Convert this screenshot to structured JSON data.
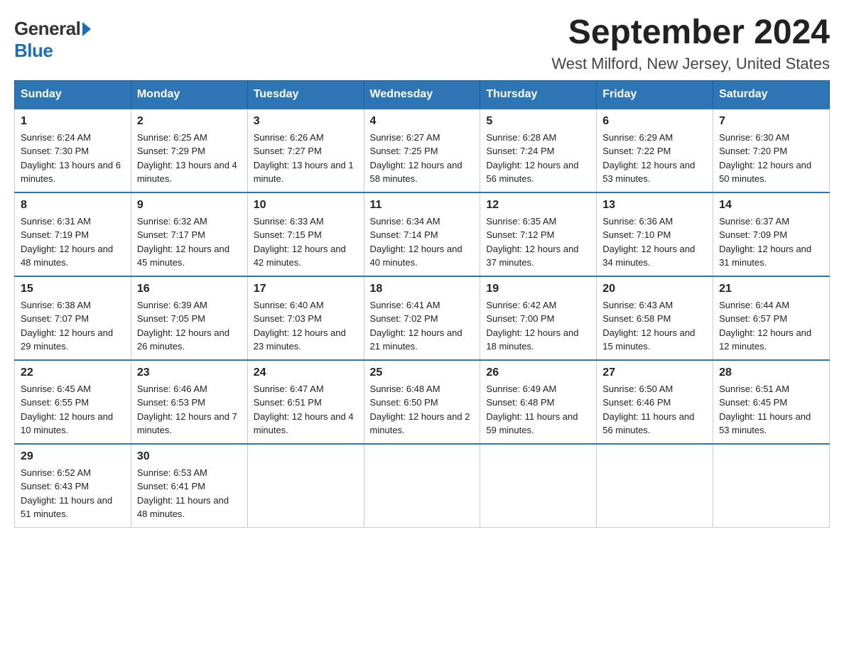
{
  "logo": {
    "general": "General",
    "blue": "Blue"
  },
  "title": "September 2024",
  "subtitle": "West Milford, New Jersey, United States",
  "days_of_week": [
    "Sunday",
    "Monday",
    "Tuesday",
    "Wednesday",
    "Thursday",
    "Friday",
    "Saturday"
  ],
  "weeks": [
    [
      {
        "day": "1",
        "sunrise": "Sunrise: 6:24 AM",
        "sunset": "Sunset: 7:30 PM",
        "daylight": "Daylight: 13 hours and 6 minutes."
      },
      {
        "day": "2",
        "sunrise": "Sunrise: 6:25 AM",
        "sunset": "Sunset: 7:29 PM",
        "daylight": "Daylight: 13 hours and 4 minutes."
      },
      {
        "day": "3",
        "sunrise": "Sunrise: 6:26 AM",
        "sunset": "Sunset: 7:27 PM",
        "daylight": "Daylight: 13 hours and 1 minute."
      },
      {
        "day": "4",
        "sunrise": "Sunrise: 6:27 AM",
        "sunset": "Sunset: 7:25 PM",
        "daylight": "Daylight: 12 hours and 58 minutes."
      },
      {
        "day": "5",
        "sunrise": "Sunrise: 6:28 AM",
        "sunset": "Sunset: 7:24 PM",
        "daylight": "Daylight: 12 hours and 56 minutes."
      },
      {
        "day": "6",
        "sunrise": "Sunrise: 6:29 AM",
        "sunset": "Sunset: 7:22 PM",
        "daylight": "Daylight: 12 hours and 53 minutes."
      },
      {
        "day": "7",
        "sunrise": "Sunrise: 6:30 AM",
        "sunset": "Sunset: 7:20 PM",
        "daylight": "Daylight: 12 hours and 50 minutes."
      }
    ],
    [
      {
        "day": "8",
        "sunrise": "Sunrise: 6:31 AM",
        "sunset": "Sunset: 7:19 PM",
        "daylight": "Daylight: 12 hours and 48 minutes."
      },
      {
        "day": "9",
        "sunrise": "Sunrise: 6:32 AM",
        "sunset": "Sunset: 7:17 PM",
        "daylight": "Daylight: 12 hours and 45 minutes."
      },
      {
        "day": "10",
        "sunrise": "Sunrise: 6:33 AM",
        "sunset": "Sunset: 7:15 PM",
        "daylight": "Daylight: 12 hours and 42 minutes."
      },
      {
        "day": "11",
        "sunrise": "Sunrise: 6:34 AM",
        "sunset": "Sunset: 7:14 PM",
        "daylight": "Daylight: 12 hours and 40 minutes."
      },
      {
        "day": "12",
        "sunrise": "Sunrise: 6:35 AM",
        "sunset": "Sunset: 7:12 PM",
        "daylight": "Daylight: 12 hours and 37 minutes."
      },
      {
        "day": "13",
        "sunrise": "Sunrise: 6:36 AM",
        "sunset": "Sunset: 7:10 PM",
        "daylight": "Daylight: 12 hours and 34 minutes."
      },
      {
        "day": "14",
        "sunrise": "Sunrise: 6:37 AM",
        "sunset": "Sunset: 7:09 PM",
        "daylight": "Daylight: 12 hours and 31 minutes."
      }
    ],
    [
      {
        "day": "15",
        "sunrise": "Sunrise: 6:38 AM",
        "sunset": "Sunset: 7:07 PM",
        "daylight": "Daylight: 12 hours and 29 minutes."
      },
      {
        "day": "16",
        "sunrise": "Sunrise: 6:39 AM",
        "sunset": "Sunset: 7:05 PM",
        "daylight": "Daylight: 12 hours and 26 minutes."
      },
      {
        "day": "17",
        "sunrise": "Sunrise: 6:40 AM",
        "sunset": "Sunset: 7:03 PM",
        "daylight": "Daylight: 12 hours and 23 minutes."
      },
      {
        "day": "18",
        "sunrise": "Sunrise: 6:41 AM",
        "sunset": "Sunset: 7:02 PM",
        "daylight": "Daylight: 12 hours and 21 minutes."
      },
      {
        "day": "19",
        "sunrise": "Sunrise: 6:42 AM",
        "sunset": "Sunset: 7:00 PM",
        "daylight": "Daylight: 12 hours and 18 minutes."
      },
      {
        "day": "20",
        "sunrise": "Sunrise: 6:43 AM",
        "sunset": "Sunset: 6:58 PM",
        "daylight": "Daylight: 12 hours and 15 minutes."
      },
      {
        "day": "21",
        "sunrise": "Sunrise: 6:44 AM",
        "sunset": "Sunset: 6:57 PM",
        "daylight": "Daylight: 12 hours and 12 minutes."
      }
    ],
    [
      {
        "day": "22",
        "sunrise": "Sunrise: 6:45 AM",
        "sunset": "Sunset: 6:55 PM",
        "daylight": "Daylight: 12 hours and 10 minutes."
      },
      {
        "day": "23",
        "sunrise": "Sunrise: 6:46 AM",
        "sunset": "Sunset: 6:53 PM",
        "daylight": "Daylight: 12 hours and 7 minutes."
      },
      {
        "day": "24",
        "sunrise": "Sunrise: 6:47 AM",
        "sunset": "Sunset: 6:51 PM",
        "daylight": "Daylight: 12 hours and 4 minutes."
      },
      {
        "day": "25",
        "sunrise": "Sunrise: 6:48 AM",
        "sunset": "Sunset: 6:50 PM",
        "daylight": "Daylight: 12 hours and 2 minutes."
      },
      {
        "day": "26",
        "sunrise": "Sunrise: 6:49 AM",
        "sunset": "Sunset: 6:48 PM",
        "daylight": "Daylight: 11 hours and 59 minutes."
      },
      {
        "day": "27",
        "sunrise": "Sunrise: 6:50 AM",
        "sunset": "Sunset: 6:46 PM",
        "daylight": "Daylight: 11 hours and 56 minutes."
      },
      {
        "day": "28",
        "sunrise": "Sunrise: 6:51 AM",
        "sunset": "Sunset: 6:45 PM",
        "daylight": "Daylight: 11 hours and 53 minutes."
      }
    ],
    [
      {
        "day": "29",
        "sunrise": "Sunrise: 6:52 AM",
        "sunset": "Sunset: 6:43 PM",
        "daylight": "Daylight: 11 hours and 51 minutes."
      },
      {
        "day": "30",
        "sunrise": "Sunrise: 6:53 AM",
        "sunset": "Sunset: 6:41 PM",
        "daylight": "Daylight: 11 hours and 48 minutes."
      },
      null,
      null,
      null,
      null,
      null
    ]
  ]
}
